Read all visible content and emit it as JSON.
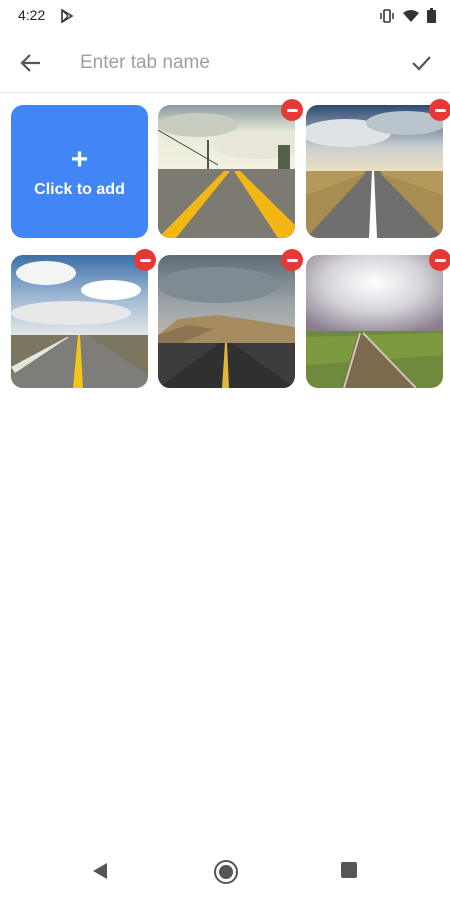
{
  "status_bar": {
    "time": "4:22",
    "icons": [
      "play-store-icon",
      "vibrate-icon",
      "wifi-icon",
      "battery-icon"
    ]
  },
  "app_bar": {
    "back_icon": "arrow-left-icon",
    "input_placeholder": "Enter tab name",
    "input_value": "",
    "confirm_icon": "check-icon"
  },
  "grid": {
    "add_tile": {
      "plus": "+",
      "label": "Click to add",
      "color": "#4285f4"
    },
    "images": [
      {
        "scene": "road with yellow lines, bright sky"
      },
      {
        "scene": "straight road, blue cloudy sky"
      },
      {
        "scene": "highway with yellow center line"
      },
      {
        "scene": "road toward hills, stormy sky"
      },
      {
        "scene": "railway track, misty sky"
      }
    ],
    "remove_icon": "minus-circle-icon",
    "remove_color": "#e53935"
  },
  "nav_bar": {
    "icons": [
      "back-triangle-icon",
      "home-circle-icon",
      "recents-square-icon"
    ]
  }
}
